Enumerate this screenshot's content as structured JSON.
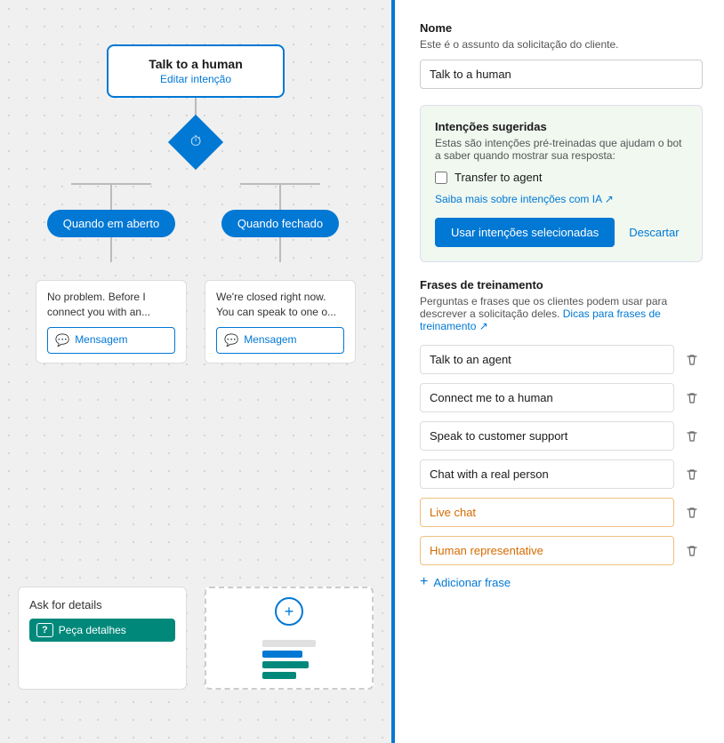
{
  "leftPanel": {
    "intentBox": {
      "title": "Talk to a human",
      "subtitle": "Editar intenção"
    },
    "diamond": "⏱",
    "branches": {
      "left": {
        "label": "Quando em aberto",
        "message": "No problem. Before I connect you with an...",
        "footerLabel": "Mensagem"
      },
      "right": {
        "label": "Quando fechado",
        "message": "We're closed right now. You can speak to one o...",
        "footerLabel": "Mensagem"
      }
    },
    "bottomCards": {
      "detailCard": {
        "title": "Ask for details",
        "actionLabel": "Peça detalhes",
        "actionIcon": "?"
      },
      "addCard": {
        "icon": "+"
      }
    }
  },
  "rightPanel": {
    "nameSection": {
      "label": "Nome",
      "description": "Este é o assunto da solicitação do cliente.",
      "value": "Talk to a human"
    },
    "suggestionsSection": {
      "label": "Intenções sugeridas",
      "description": "Estas são intenções pré-treinadas que ajudam o bot a saber quando mostrar sua resposta:",
      "checkbox": {
        "label": "Transfer to agent",
        "checked": false
      },
      "linkText": "Saiba mais sobre intenções com IA ↗",
      "buttons": {
        "primary": "Usar intenções selecionadas",
        "secondary": "Descartar"
      }
    },
    "trainingSection": {
      "label": "Frases de treinamento",
      "description": "Perguntas e frases que os clientes podem usar para descrever a solicitação deles.",
      "linkText": "Dicas para frases de treinamento ↗",
      "phrases": [
        {
          "value": "Talk to an agent",
          "style": "normal"
        },
        {
          "value": "Connect me to a human",
          "style": "normal"
        },
        {
          "value": "Speak to customer support",
          "style": "normal"
        },
        {
          "value": "Chat with a real person",
          "style": "normal"
        },
        {
          "value": "Live chat",
          "style": "orange"
        },
        {
          "value": "Human representative",
          "style": "orange"
        }
      ],
      "addPhraseLabel": "Adicionar frase"
    }
  }
}
